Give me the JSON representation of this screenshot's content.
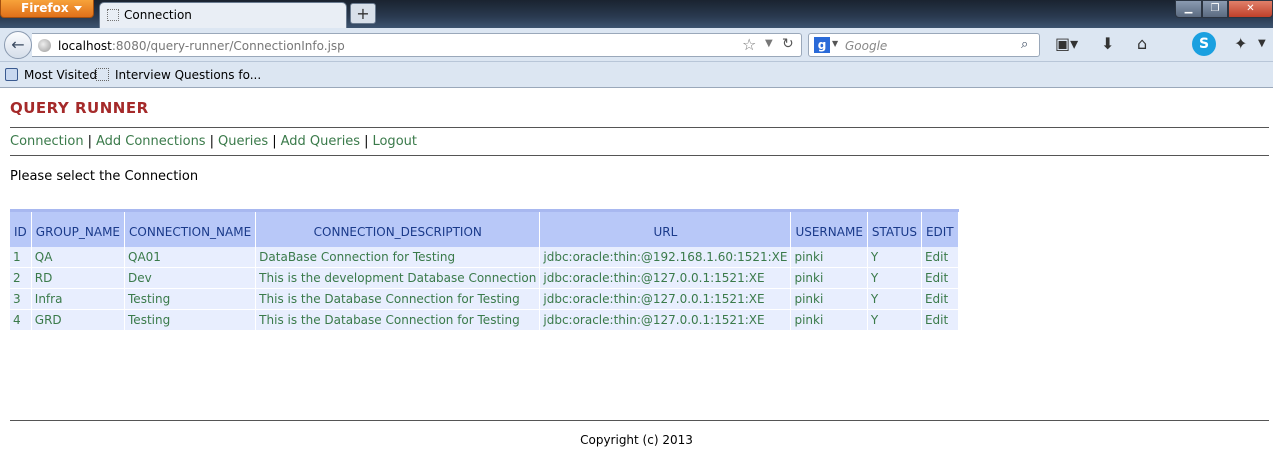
{
  "browser": {
    "menu_button": "Firefox",
    "tab_title": "Connection",
    "new_tab": "+",
    "url_host": "localhost",
    "url_rest": ":8080/query-runner/ConnectionInfo.jsp",
    "search_placeholder": "Google",
    "bookmarks": [
      "Most Visited",
      "Interview Questions fo..."
    ]
  },
  "page": {
    "app_title": "QUERY RUNNER",
    "menu": {
      "connection": "Connection",
      "add_connections": "Add Connections",
      "queries": "Queries",
      "add_queries": "Add Queries",
      "logout": "Logout",
      "separator": "|"
    },
    "prompt": "Please select the Connection",
    "table": {
      "headers": [
        "ID",
        "GROUP_NAME",
        "CONNECTION_NAME",
        "CONNECTION_DESCRIPTION",
        "URL",
        "USERNAME",
        "STATUS",
        "EDIT"
      ],
      "rows": [
        [
          "1",
          "QA",
          "QA01",
          "DataBase Connection for Testing",
          "jdbc:oracle:thin:@192.168.1.60:1521:XE",
          "pinki",
          "Y",
          "Edit"
        ],
        [
          "2",
          "RD",
          "Dev",
          "This is the development Database Connection",
          "jdbc:oracle:thin:@127.0.0.1:1521:XE",
          "pinki",
          "Y",
          "Edit"
        ],
        [
          "3",
          "Infra",
          "Testing",
          "This is the Database Connection for Testing",
          "jdbc:oracle:thin:@127.0.0.1:1521:XE",
          "pinki",
          "Y",
          "Edit"
        ],
        [
          "4",
          "GRD",
          "Testing",
          "This is the Database Connection for Testing",
          "jdbc:oracle:thin:@127.0.0.1:1521:XE",
          "pinki",
          "Y",
          "Edit"
        ]
      ]
    },
    "footer": "Copyright (c) 2013"
  },
  "colors": {
    "title": "#a52a2a",
    "link": "#3a7a4a",
    "table_header_bg": "#b8c8f8",
    "table_header_text": "#1a3a8a",
    "table_row_bg": "#e8eefe"
  }
}
